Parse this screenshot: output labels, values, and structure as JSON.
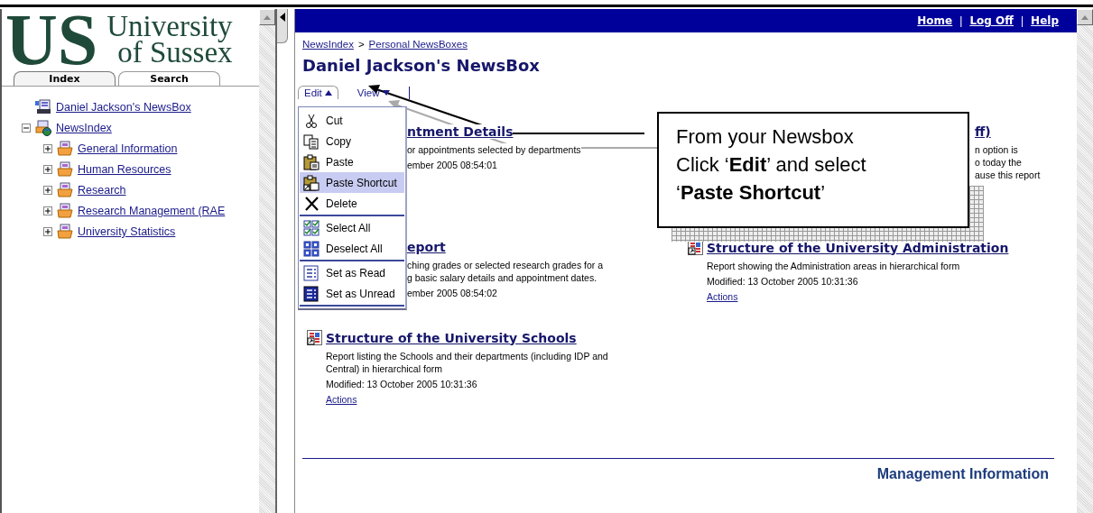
{
  "sidebar": {
    "logo": {
      "mark": "US",
      "name_lines": [
        "University",
        "of Sussex"
      ]
    },
    "tabs": [
      {
        "label": "Index",
        "selected": true
      },
      {
        "label": "Search",
        "selected": false
      }
    ],
    "tree": [
      {
        "label": "Daniel Jackson's NewsBox",
        "kind": "newsbox"
      },
      {
        "label": "NewsIndex",
        "kind": "index",
        "expanded": true,
        "children": [
          {
            "label": "General Information",
            "kind": "folder",
            "expanded": false
          },
          {
            "label": "Human Resources",
            "kind": "folder",
            "expanded": false
          },
          {
            "label": "Research",
            "kind": "folder",
            "expanded": false
          },
          {
            "label": "Research Management (RAE",
            "kind": "folder",
            "expanded": false
          },
          {
            "label": "University Statistics",
            "kind": "folder",
            "expanded": false
          }
        ]
      }
    ]
  },
  "header": {
    "nav": [
      {
        "kind": "link",
        "text": "Home"
      },
      {
        "kind": "separator",
        "text": "|"
      },
      {
        "kind": "link",
        "text": "Log Off"
      },
      {
        "kind": "separator",
        "text": "|"
      },
      {
        "kind": "link",
        "text": "Help"
      }
    ]
  },
  "breadcrumb": [
    {
      "kind": "link",
      "text": "NewsIndex"
    },
    {
      "kind": "separator",
      "text": ">"
    },
    {
      "kind": "link",
      "text": "Personal NewsBoxes"
    }
  ],
  "title": "Daniel Jackson's NewsBox",
  "toolbar": [
    {
      "label": "Edit",
      "expanded": true
    },
    {
      "label": "View",
      "expanded": false
    }
  ],
  "menu": [
    [
      {
        "label": "Cut",
        "kind": "cut",
        "selected": false
      },
      {
        "label": "Copy",
        "kind": "copy",
        "selected": false
      },
      {
        "label": "Paste",
        "kind": "paste",
        "selected": false
      },
      {
        "label": "Paste Shortcut",
        "kind": "paste-shortcut",
        "selected": true
      },
      {
        "label": "Delete",
        "kind": "delete",
        "selected": false
      }
    ],
    [
      {
        "label": "Select All",
        "kind": "select-all",
        "selected": false
      },
      {
        "label": "Deselect All",
        "kind": "deselect-all",
        "selected": false
      }
    ],
    [
      {
        "label": "Set as Read",
        "kind": "read",
        "selected": false
      },
      {
        "label": "Set as Unread",
        "kind": "unread",
        "selected": false
      }
    ]
  ],
  "report_rows": [
    [
      {
        "kind": "covered",
        "title": "ntment Details",
        "description": "or appointments selected by departments",
        "modified": "ember 2005 08:54:01"
      },
      {
        "kind": "covered",
        "title": "ff)",
        "description": "n option is\no today the\nause this report"
      }
    ],
    [
      {
        "kind": "covered",
        "title": "eport",
        "description": "ching grades or selected research grades for a\ng basic salary details and appointment dates.",
        "modified": "ember 2005 08:54:02"
      },
      {
        "kind": "full",
        "title": "Structure of the University Administration",
        "description": "Report showing the Administration areas in hierarchical form",
        "modified": "Modified: 13 October 2005 10:31:36",
        "action": "Actions"
      }
    ],
    [
      {
        "kind": "full",
        "title": "Structure of the University Schools",
        "description": "Report listing the Schools and their departments (including IDP and Central) in hierarchical form",
        "modified": "Modified: 13 October 2005 10:31:36",
        "action": "Actions"
      }
    ]
  ],
  "footer": "Management Information",
  "callout": {
    "lines": [
      "From your Newsbox",
      "Click ‘**Edit**’ and select",
      "‘**Paste Shortcut**’"
    ]
  }
}
